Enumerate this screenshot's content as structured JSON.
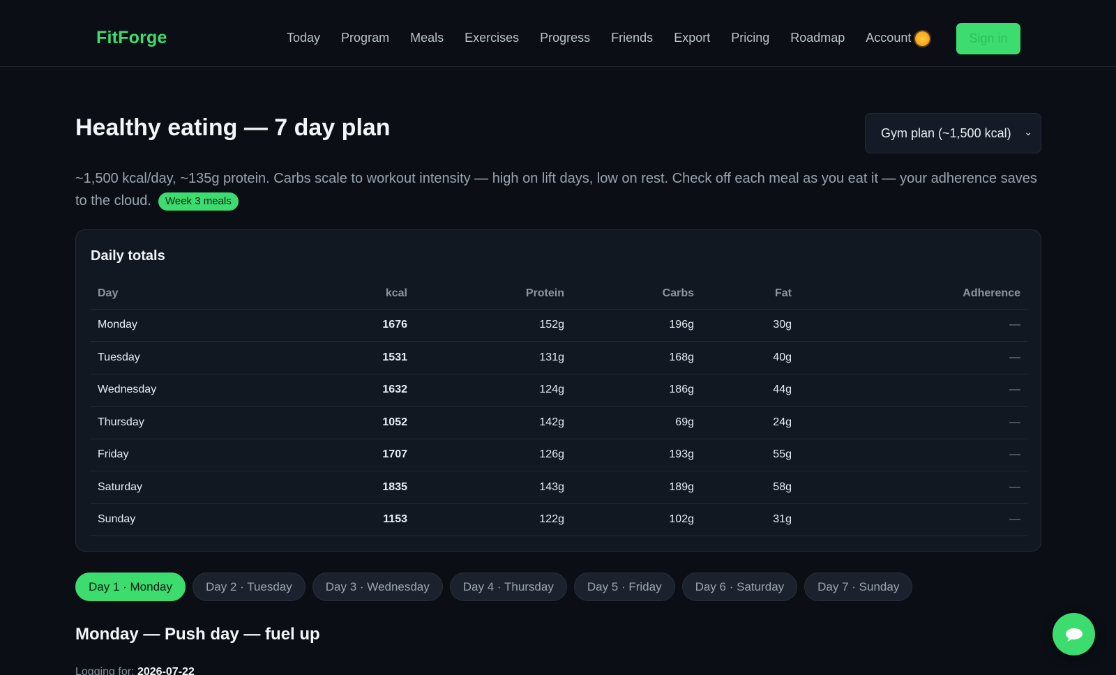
{
  "header": {
    "brand": "FitForge",
    "nav": [
      "Today",
      "Program",
      "Meals",
      "Exercises",
      "Progress",
      "Friends",
      "Export",
      "Pricing",
      "Roadmap",
      "Account"
    ],
    "theme_icon": "sun-icon",
    "signin_label": "Sign in",
    "accent_color": "#3ddc6f"
  },
  "page": {
    "title": "Healthy eating — 7 day plan",
    "plan_select_value": "Gym plan (~1,500 kcal)",
    "intro": "~1,500 kcal/day, ~135g protein. Carbs scale to workout intensity — high on lift days, low on rest. Check off each meal as you eat it — your adherence saves to the cloud.",
    "badge": "Week 3 meals"
  },
  "totals": {
    "title": "Daily totals",
    "columns": [
      "Day",
      "kcal",
      "Protein",
      "Carbs",
      "Fat",
      "Adherence"
    ],
    "rows": [
      [
        "Monday",
        "1676",
        "152g",
        "196g",
        "30g",
        "—"
      ],
      [
        "Tuesday",
        "1531",
        "131g",
        "168g",
        "40g",
        "—"
      ],
      [
        "Wednesday",
        "1632",
        "124g",
        "186g",
        "44g",
        "—"
      ],
      [
        "Thursday",
        "1052",
        "142g",
        "69g",
        "24g",
        "—"
      ],
      [
        "Friday",
        "1707",
        "126g",
        "193g",
        "55g",
        "—"
      ],
      [
        "Saturday",
        "1835",
        "143g",
        "189g",
        "58g",
        "—"
      ],
      [
        "Sunday",
        "1153",
        "122g",
        "102g",
        "31g",
        "—"
      ]
    ]
  },
  "day_tabs": [
    "Day 1 · Monday",
    "Day 2 · Tuesday",
    "Day 3 · Wednesday",
    "Day 4 · Thursday",
    "Day 5 · Friday",
    "Day 6 · Saturday",
    "Day 7 · Sunday"
  ],
  "active_day_index": 0,
  "day": {
    "heading": "Monday — Push day — fuel up",
    "logging_label": "Logging for:",
    "logging_date": "2026-07-22"
  },
  "chat_icon": "chat-bubble-icon"
}
